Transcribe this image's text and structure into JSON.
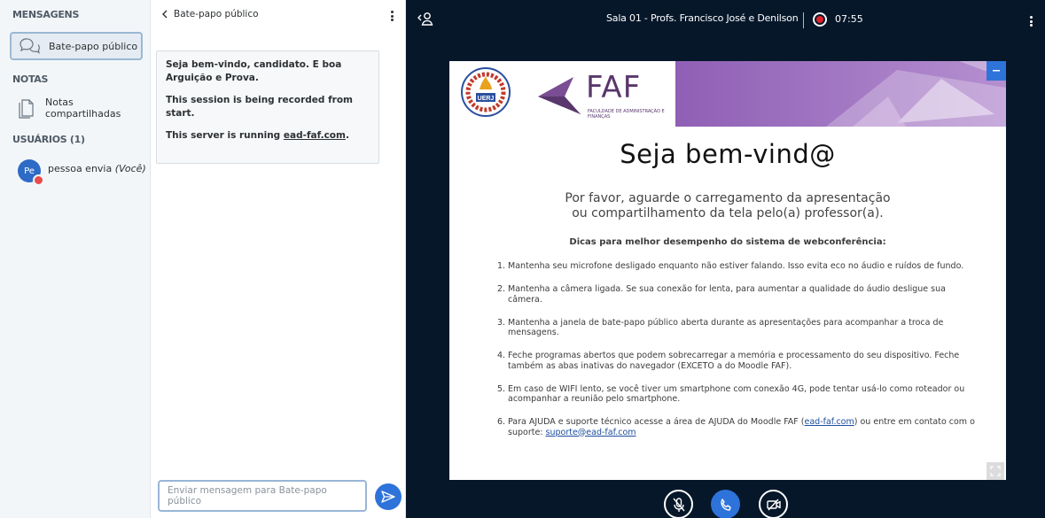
{
  "sidebar": {
    "messages_title": "MENSAGENS",
    "public_chat_label": "Bate-papo público",
    "notes_title": "NOTAS",
    "shared_notes_label": "Notas compartilhadas",
    "users_title": "USUÁRIOS (1)",
    "user": {
      "initials": "Pe",
      "name": "pessoa envia",
      "you_label": "(Você)"
    }
  },
  "chat": {
    "header_title": "Bate-papo público",
    "welcome_line1": "Seja bem-vindo, candidato. E boa Arguição e Prova.",
    "welcome_line2": "This session is being recorded from start.",
    "welcome_line3_prefix": "This server is running ",
    "welcome_line3_link": "ead-faf.com",
    "welcome_line3_suffix": ".",
    "input_placeholder": "Enviar mensagem para Bate-papo público"
  },
  "presentation": {
    "room_title": "Sala 01 - Profs. Francisco José e Denilson",
    "recording_time": "07:55",
    "slide": {
      "uerj_label": "UERJ",
      "faf_word": "FAF",
      "faf_subtitle": "FACULDADE DE ADMINISTRAÇÃO E FINANÇAS",
      "title": "Seja bem-vind@",
      "subtitle_line1": "Por favor, aguarde o carregamento da apresentação",
      "subtitle_line2": "ou compartilhamento da tela pelo(a) professor(a).",
      "tips_heading": "Dicas para melhor desempenho do sistema de webconferência:",
      "tips": [
        {
          "num": "1.",
          "text": "Mantenha seu microfone desligado enquanto não estiver falando. Isso evita eco no áudio e ruídos de fundo."
        },
        {
          "num": "2.",
          "text": "Mantenha a câmera ligada. Se sua conexão for lenta, para aumentar a qualidade do áudio desligue sua câmera."
        },
        {
          "num": "3.",
          "text": "Mantenha a janela de bate-papo público aberta durante as apresentações para acompanhar a troca de mensagens."
        },
        {
          "num": "4.",
          "text": "Feche programas abertos que podem sobrecarregar a memória e processamento do seu dispositivo. Feche também as abas inativas do navegador (EXCETO a do Moodle FAF)."
        },
        {
          "num": "5.",
          "text": "Em caso de WIFI lento, se você tiver um smartphone com conexão 4G, pode tentar usá-lo como roteador ou acompanhar a reunião pelo smartphone."
        }
      ],
      "tip6": {
        "num": "6.",
        "text_a": "Para AJUDA e suporte técnico acesse a área de AJUDA do Moodle FAF (",
        "link1": "ead-faf.com",
        "text_b": ") ou entre em contato com o suporte: ",
        "link2": "suporte@ead-faf.com"
      }
    }
  },
  "icons": {
    "chat": "chat-bubbles-icon",
    "notes": "document-icon",
    "back": "chevron-left-icon",
    "menu": "kebab-menu-icon",
    "send": "send-arrow-icon",
    "users_toggle": "users-toggle-icon",
    "record": "record-icon",
    "mute": "mic-off-icon",
    "leave_audio": "phone-icon",
    "camera": "camera-off-icon",
    "minimize": "minimize-icon",
    "fullscreen": "fullscreen-icon"
  },
  "colors": {
    "accent": "#2e73d9",
    "presentation_bg": "#06172a",
    "sidebar_bg": "#f3f6f9",
    "faf_purple": "#59376d",
    "record_red": "#e0202a"
  }
}
